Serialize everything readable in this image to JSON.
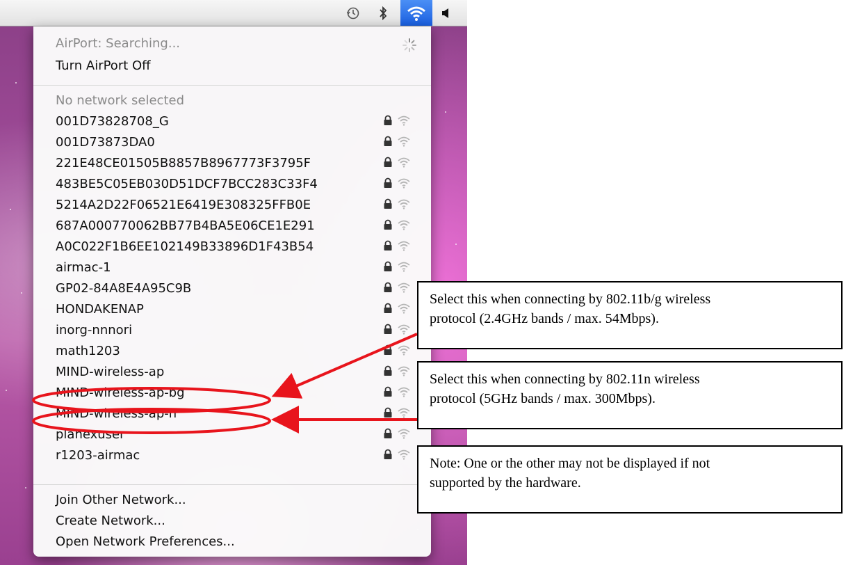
{
  "menu": {
    "status": "AirPort: Searching...",
    "toggle": "Turn AirPort Off",
    "no_selection": "No network selected",
    "networks": [
      "001D73828708_G",
      "001D73873DA0",
      "221E48CE01505B8857B8967773F3795F",
      "483BE5C05EB030D51DCF7BCC283C33F4",
      "5214A2D22F06521E6419E308325FFB0E",
      "687A000770062BB77B4BA5E06CE1E291",
      "A0C022F1B6EE102149B33896D1F43B54",
      "airmac-1",
      "GP02-84A8E4A95C9B",
      "HONDAKENAP",
      "inorg-nnnori",
      "math1203",
      "MIND-wireless-ap",
      "MIND-wireless-ap-bg",
      "MIND-wireless-ap-n",
      "planexuser",
      "r1203-airmac"
    ],
    "join_other": "Join Other Network...",
    "create": "Create Network...",
    "preferences": "Open Network Preferences..."
  },
  "callouts": {
    "bg_line1": "Select this when connecting by 802.11b/g wireless",
    "bg_line2": "protocol (2.4GHz bands / max. 54Mbps).",
    "n_line1": "Select this when connecting by 802.11n wireless",
    "n_line2": "protocol (5GHz bands / max. 300Mbps).",
    "note_line1": "Note: One or the other may not be displayed if not",
    "note_line2": "supported by the hardware."
  },
  "colors": {
    "accent_wifi": "#2a6cf0",
    "annotation_red": "#e8141c",
    "wallpaper": "#a24c9a"
  },
  "icons": [
    "time-machine-icon",
    "bluetooth-icon",
    "wifi-icon",
    "volume-icon",
    "lock-icon",
    "wifi-signal-icon",
    "spinner-icon"
  ]
}
